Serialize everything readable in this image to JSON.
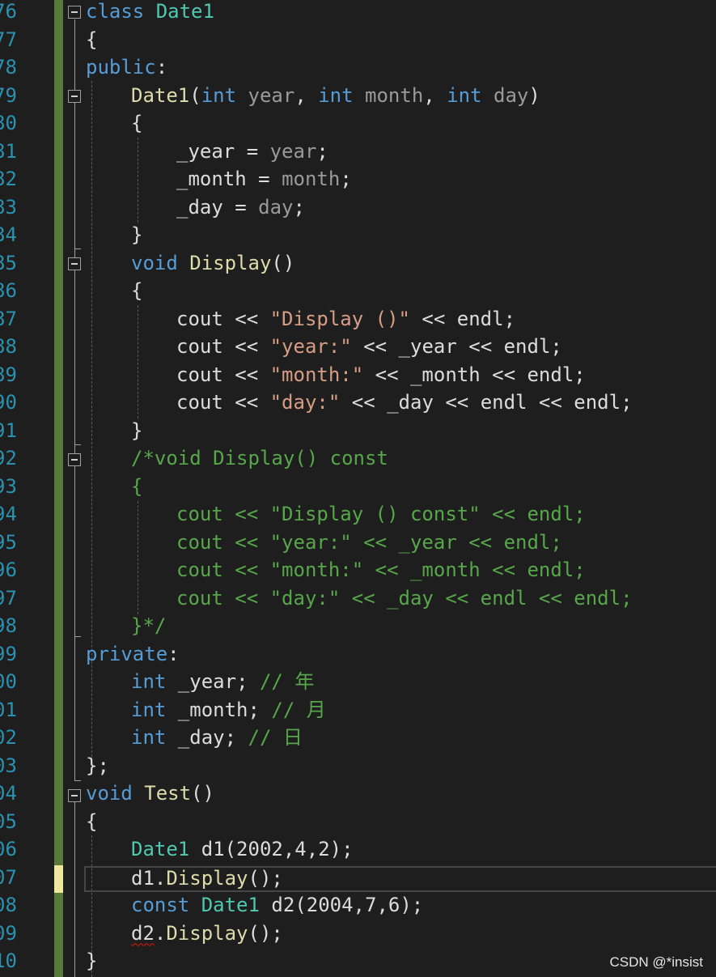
{
  "line_numbers": [
    "76",
    "77",
    "78",
    "79",
    "80",
    "81",
    "82",
    "83",
    "84",
    "85",
    "86",
    "87",
    "88",
    "89",
    "90",
    "91",
    "92",
    "93",
    "94",
    "95",
    "96",
    "97",
    "98",
    "99",
    "00",
    "01",
    "02",
    "03",
    "04",
    "05",
    "06",
    "07",
    "08",
    "09",
    "10"
  ],
  "code": {
    "l76": {
      "kw": "class",
      "name": "Date1"
    },
    "l77": {
      "brace": "{"
    },
    "l78": {
      "access": "public",
      "colon": ":"
    },
    "l79": {
      "fn": "Date1",
      "open": "(",
      "t1": "int",
      "p1": "year",
      "c1": ", ",
      "t2": "int",
      "p2": "month",
      "c2": ", ",
      "t3": "int",
      "p3": "day",
      "close": ")"
    },
    "l80": {
      "brace": "{"
    },
    "l81": {
      "lhs": "_year",
      "op": " = ",
      "rhs": "year",
      "semi": ";"
    },
    "l82": {
      "lhs": "_month",
      "op": " = ",
      "rhs": "month",
      "semi": ";"
    },
    "l83": {
      "lhs": "_day",
      "op": " = ",
      "rhs": "day",
      "semi": ";"
    },
    "l84": {
      "brace": "}"
    },
    "l85": {
      "kw": "void",
      "fn": "Display",
      "parens": "()"
    },
    "l86": {
      "brace": "{"
    },
    "l87": {
      "a": "cout << ",
      "s": "\"Display ()\"",
      "b": " << endl;"
    },
    "l88": {
      "a": "cout << ",
      "s": "\"year:\"",
      "b": " << _year << endl;"
    },
    "l89": {
      "a": "cout << ",
      "s": "\"month:\"",
      "b": " << _month << endl;"
    },
    "l90": {
      "a": "cout << ",
      "s": "\"day:\"",
      "b": " << _day << endl << endl;"
    },
    "l91": {
      "brace": "}"
    },
    "l92": {
      "text": "/*void Display() const"
    },
    "l93": {
      "text": "{"
    },
    "l94": {
      "text": "cout << \"Display () const\" << endl;"
    },
    "l95": {
      "text": "cout << \"year:\" << _year << endl;"
    },
    "l96": {
      "text": "cout << \"month:\" << _month << endl;"
    },
    "l97": {
      "text": "cout << \"day:\" << _day << endl << endl;"
    },
    "l98": {
      "text": "}*/"
    },
    "l99": {
      "access": "private",
      "colon": ":"
    },
    "l100": {
      "kw": "int",
      "name": " _year",
      "semi": ";",
      "comment": " // 年"
    },
    "l101": {
      "kw": "int",
      "name": " _month",
      "semi": ";",
      "comment": " // 月"
    },
    "l102": {
      "kw": "int",
      "name": " _day",
      "semi": ";",
      "comment": " // 日"
    },
    "l103": {
      "text": "};"
    },
    "l104": {
      "kw": "void",
      "fn": "Test",
      "parens": "()"
    },
    "l105": {
      "brace": "{"
    },
    "l106": {
      "ty": "Date1",
      "var": "d1",
      "args": "(2002,4,2);"
    },
    "l107": {
      "obj": "d1",
      "dot": ".",
      "fn": "Display",
      "rest": "();"
    },
    "l108": {
      "kw": "const",
      "ty": "Date1",
      "var": "d2",
      "args": "(2004,7,6);"
    },
    "l109": {
      "obj": "d2",
      "dot": ".",
      "fn": "Display",
      "rest": "();"
    },
    "l110": {
      "brace": "}"
    }
  },
  "watermark": "CSDN @*insist",
  "colors": {
    "background": "#1e1e1e",
    "keyword": "#569cd6",
    "type": "#4ec9b0",
    "function": "#dcdcaa",
    "parameter": "#9a9a9a",
    "string": "#d69d85",
    "comment": "#57a64a",
    "line_number": "#2b91af",
    "change_bar": "#57793a"
  }
}
